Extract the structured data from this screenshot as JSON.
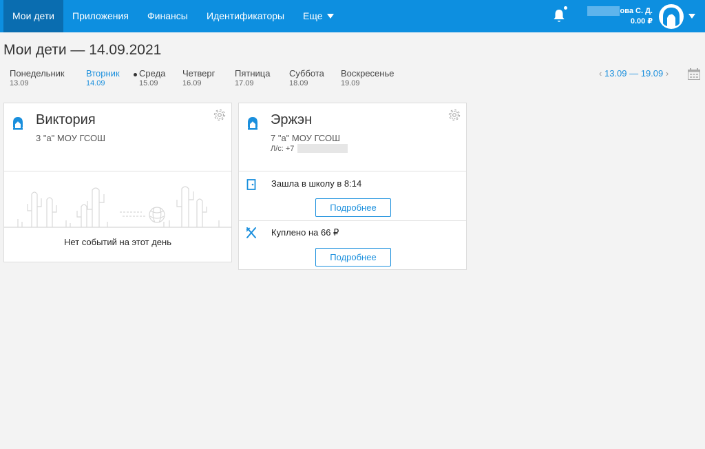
{
  "nav": {
    "items": [
      {
        "label": "Мои дети"
      },
      {
        "label": "Приложения"
      },
      {
        "label": "Финансы"
      },
      {
        "label": "Идентификаторы"
      },
      {
        "label": "Еще"
      }
    ]
  },
  "user": {
    "name": "ова С. Д.",
    "balance": "0.00 ₽"
  },
  "page": {
    "title": "Мои дети — 14.09.2021"
  },
  "week": {
    "days": [
      {
        "name": "Понедельник",
        "date": "13.09"
      },
      {
        "name": "Вторник",
        "date": "14.09"
      },
      {
        "name": "Среда",
        "date": "15.09"
      },
      {
        "name": "Четверг",
        "date": "16.09"
      },
      {
        "name": "Пятница",
        "date": "17.09"
      },
      {
        "name": "Суббота",
        "date": "18.09"
      },
      {
        "name": "Воскресенье",
        "date": "19.09"
      }
    ],
    "selected_index": 1,
    "range": "13.09 — 19.09",
    "prev_arrow": "‹",
    "next_arrow": "›"
  },
  "children": [
    {
      "name": "Виктория",
      "class": "3 \"а\" МОУ ГСОШ",
      "no_events": "Нет событий на этот день"
    },
    {
      "name": "Эржэн",
      "class": "7 \"а\" МОУ ГСОШ",
      "account": "Л/с: +7",
      "events": [
        {
          "text": "Зашла в школу в 8:14",
          "button": "Подробнее",
          "icon": "door-icon"
        },
        {
          "text": "Куплено на 66 ₽",
          "button": "Подробнее",
          "icon": "fork-knife-icon"
        }
      ]
    }
  ],
  "colors": {
    "topbar": "#0d8fe0",
    "accent": "#1a8fdd",
    "background": "#f3f3f3"
  }
}
